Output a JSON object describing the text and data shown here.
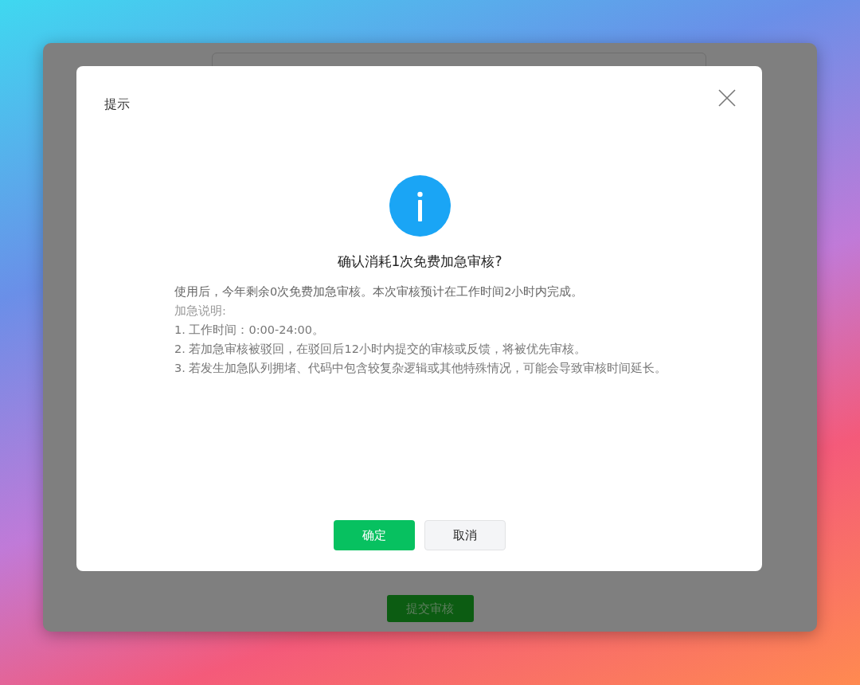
{
  "background_form": {
    "submit_button": {
      "label": "提交审核"
    }
  },
  "dialog": {
    "title": "提示",
    "heading": "确认消耗1次免费加急审核?",
    "message": "使用后，今年剩余0次免费加急审核。本次审核预计在工作时间2小时内完成。",
    "notes_title": "加急说明:",
    "notes": [
      "1. 工作时间：0:00-24:00。",
      "2. 若加急审核被驳回，在驳回后12小时内提交的审核或反馈，将被优先审核。",
      "3. 若发生加急队列拥堵、代码中包含较复杂逻辑或其他特殊情况，可能会导致审核时间延长。"
    ],
    "buttons": [
      {
        "label": "确定",
        "kind": "primary"
      },
      {
        "label": "取消",
        "kind": "secondary"
      }
    ]
  }
}
